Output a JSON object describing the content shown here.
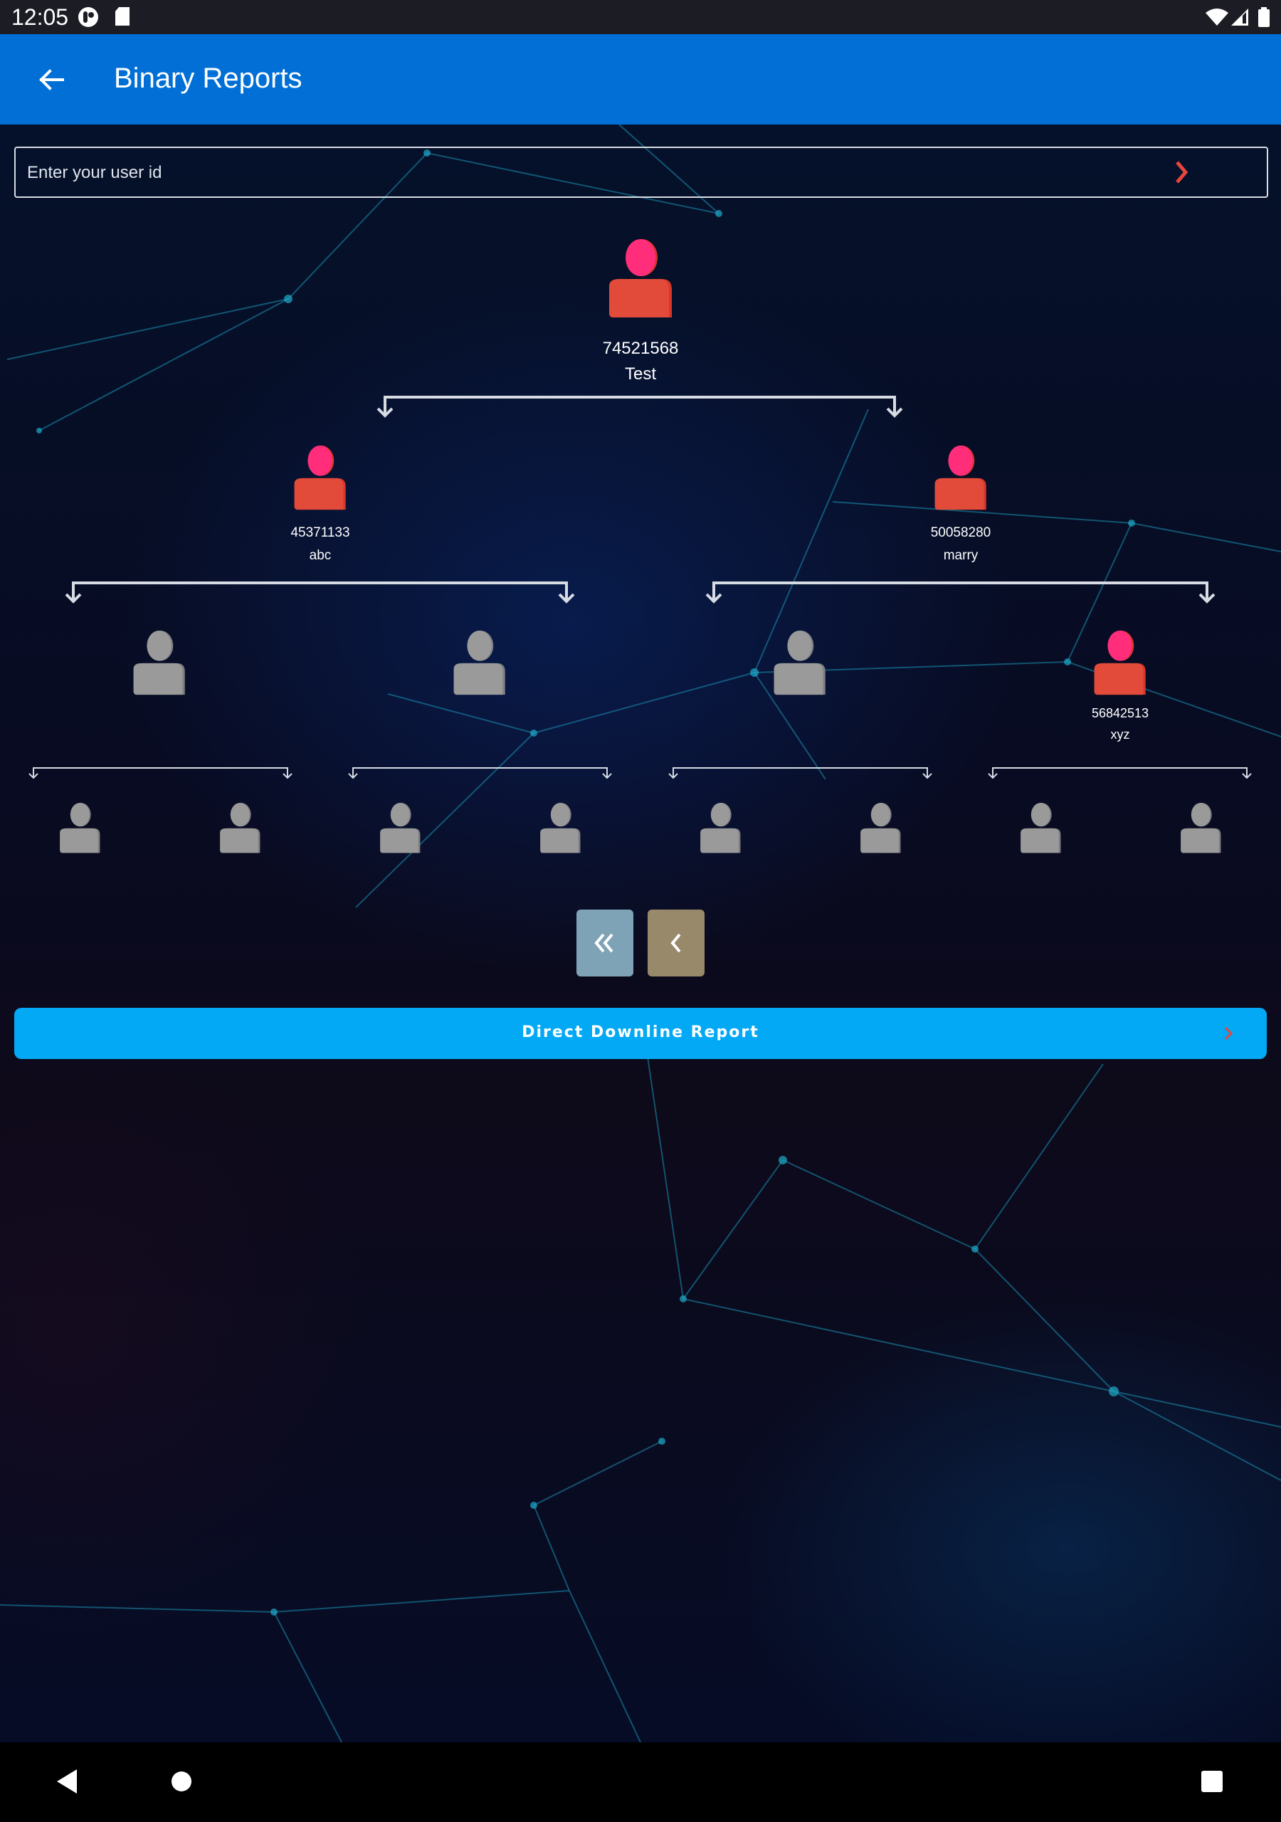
{
  "status_bar": {
    "time": "12:05",
    "left_icons": [
      "notification-app-icon",
      "sd-card-icon"
    ],
    "right_icons": [
      "wifi-icon",
      "cellular-signal-icon",
      "battery-icon"
    ]
  },
  "app_bar": {
    "back_icon": "arrow-left-icon",
    "title": "Binary Reports"
  },
  "search": {
    "placeholder": "Enter your user id",
    "value": "",
    "submit_icon": "chevron-right-icon"
  },
  "colors": {
    "app_bar": "#016FD6",
    "active_head": "#FF2D7A",
    "active_body": "#E24B3A",
    "inactive": "#9A9A9A",
    "accent_arrow": "#E8453C",
    "report_button": "#03A9F4",
    "first_page_button": "#7FA3B6",
    "prev_page_button": "#98896A"
  },
  "tree": {
    "root": {
      "id": "74521568",
      "name": "Test",
      "active": true
    },
    "level2": [
      {
        "id": "45371133",
        "name": "abc",
        "active": true
      },
      {
        "id": "50058280",
        "name": "marry",
        "active": true
      }
    ],
    "level3": [
      {
        "id": "",
        "name": "",
        "active": false
      },
      {
        "id": "",
        "name": "",
        "active": false
      },
      {
        "id": "",
        "name": "",
        "active": false
      },
      {
        "id": "56842513",
        "name": "xyz",
        "active": true
      }
    ],
    "level4": [
      {
        "id": "",
        "name": "",
        "active": false
      },
      {
        "id": "",
        "name": "",
        "active": false
      },
      {
        "id": "",
        "name": "",
        "active": false
      },
      {
        "id": "",
        "name": "",
        "active": false
      },
      {
        "id": "",
        "name": "",
        "active": false
      },
      {
        "id": "",
        "name": "",
        "active": false
      },
      {
        "id": "",
        "name": "",
        "active": false
      },
      {
        "id": "",
        "name": "",
        "active": false
      }
    ]
  },
  "pager": {
    "first_icon": "double-chevron-left-icon",
    "prev_icon": "chevron-left-icon"
  },
  "report_button": {
    "label": "Direct Downline Report",
    "icon": "chevron-right-icon"
  },
  "nav_bar": {
    "buttons": [
      "back-triangle-icon",
      "home-circle-icon",
      "recents-square-icon"
    ]
  }
}
